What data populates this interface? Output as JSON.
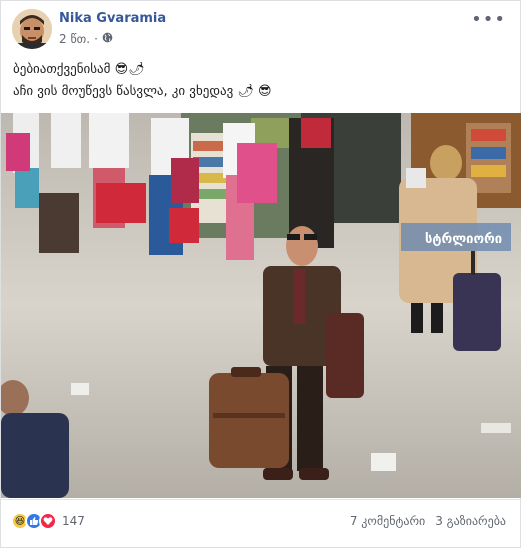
{
  "post": {
    "author": "Nika Gvaramia",
    "time": "2 წთ.",
    "separator": "·",
    "privacy_icon": "globe-icon",
    "more_icon": "more-options-icon",
    "text_line1": "ბებიათქვენისამ",
    "text_line1_emojis": [
      "😎",
      "🌶"
    ],
    "text_line2": "აჩი ვის მოუწევს წასვლა, კი ვხედავ",
    "text_line2_emojis": [
      "🌶",
      "😎"
    ]
  },
  "photo": {
    "sign_text": "სტრლიორი"
  },
  "footer": {
    "reactions": [
      "haha-icon",
      "like-icon",
      "love-icon"
    ],
    "reaction_count": "147",
    "comments": "7 კომენტარი",
    "shares": "3 გაზიარება"
  },
  "colors": {
    "author": "#365899",
    "meta": "#616770",
    "like": "#3578e5",
    "love": "#f0284a",
    "haha": "#f7c946"
  }
}
